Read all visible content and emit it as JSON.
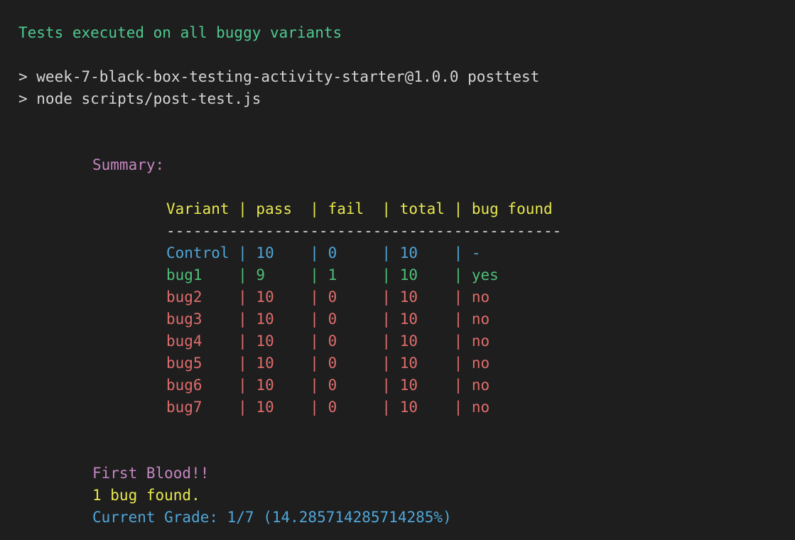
{
  "header": {
    "status_line": "Tests executed on all buggy variants",
    "cmd_line_1": "> week-7-black-box-testing-activity-starter@1.0.0 posttest",
    "cmd_line_2": "> node scripts/post-test.js"
  },
  "summary": {
    "title": "Summary:",
    "header_row": "Variant | pass  | fail  | total | bug found",
    "separator": "--------------------------------------------",
    "rows": [
      "Control | 10    | 0     | 10    | -",
      "bug1    | 9     | 1     | 10    | yes",
      "bug2    | 10    | 0     | 10    | no",
      "bug3    | 10    | 0     | 10    | no",
      "bug4    | 10    | 0     | 10    | no",
      "bug5    | 10    | 0     | 10    | no",
      "bug6    | 10    | 0     | 10    | no",
      "bug7    | 10    | 0     | 10    | no"
    ]
  },
  "result": {
    "banner": "First Blood!!",
    "found": "1 bug found.",
    "grade": "Current Grade: 1/7 (14.285714285714285%)"
  },
  "colors": {
    "background": "#1e1e1e",
    "green": "#4ec98f",
    "magenta": "#c586c0",
    "yellow": "#e8e84f",
    "blue": "#4fa6d8",
    "red": "#e06c6c"
  }
}
